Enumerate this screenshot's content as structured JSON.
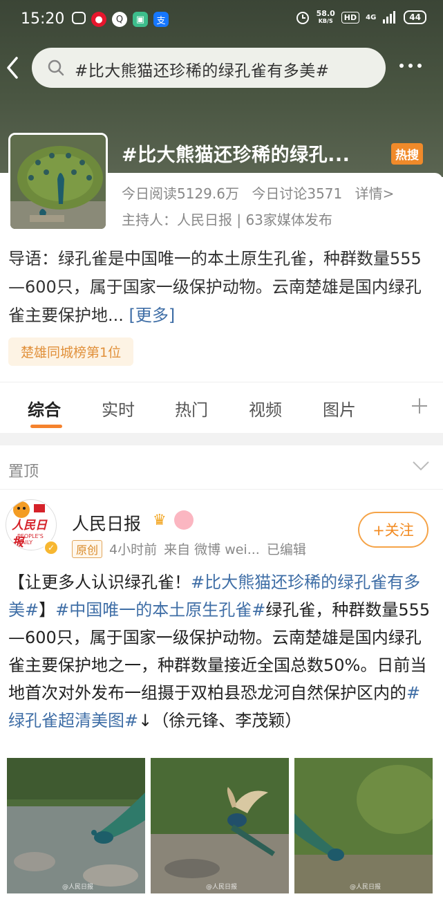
{
  "status_bar": {
    "time": "15:20",
    "speed_value": "58.0",
    "speed_unit": "KB/S",
    "hd": "HD",
    "network": "4G",
    "battery": "44"
  },
  "search": {
    "query": "#比大熊猫还珍稀的绿孔雀有多美#"
  },
  "topic": {
    "title": "#比大熊猫还珍稀的绿孔...",
    "hot_badge": "热搜",
    "stats": {
      "reads": "今日阅读5129.6万",
      "discussions": "今日讨论3571",
      "details": "详情>"
    },
    "host": "主持人：人民日报 | 63家媒体发布",
    "intro_text": "导语：绿孔雀是中国唯一的本土原生孔雀，种群数量555—600只，属于国家一级保护动物。云南楚雄是国内绿孔雀主要保护地... ",
    "intro_more": "[更多]",
    "rank_badge": "楚雄同城榜第1位"
  },
  "tabs": [
    {
      "label": "综合"
    },
    {
      "label": "实时"
    },
    {
      "label": "热门"
    },
    {
      "label": "视频"
    },
    {
      "label": "图片"
    }
  ],
  "pinned_label": "置顶",
  "post": {
    "avatar_text": "人民日报",
    "avatar_sub": "PEOPLE'S DAILY",
    "author": "人民日报",
    "original_tag": "原创",
    "time": "4小时前",
    "source": "来自 微博 wei...",
    "edited": "已编辑",
    "follow_label": "+关注",
    "text_1": "【让更多人认识绿孔雀！",
    "tag_1": "#比大熊猫还珍稀的绿孔雀有多美#",
    "text_2": "】",
    "tag_2": "#中国唯一的本土原生孔雀#",
    "text_3": "绿孔雀，种群数量555—600只，属于国家一级保护动物。云南楚雄是国内绿孔雀主要保护地之一，种群数量接近全国总数50%。日前当地首次对外发布一组摄于双柏县恐龙河自然保护区内的",
    "tag_3": "#绿孔雀超清美图#",
    "text_4": "↓（徐元锋、李茂颖）",
    "photo_watermark": "@人民日报"
  }
}
